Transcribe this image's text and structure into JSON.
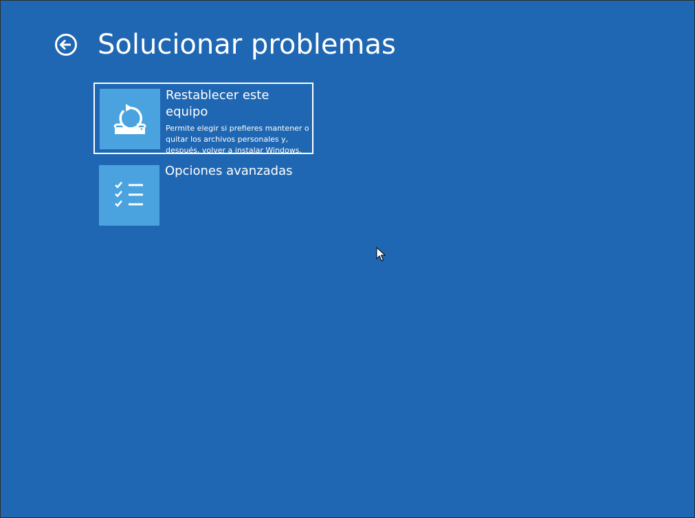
{
  "header": {
    "title": "Solucionar problemas",
    "back_icon": "back-arrow-circle-icon"
  },
  "tiles": [
    {
      "title": "Restablecer este equipo",
      "description": "Permite elegir si prefieres mantener o\nquitar los archivos personales y,\ndespués, volver a instalar Windows.",
      "icon": "reset-pc-icon",
      "selected": true
    },
    {
      "title": "Opciones avanzadas",
      "description": "",
      "icon": "checklist-icon",
      "selected": false
    }
  ],
  "colors": {
    "background": "#1f67b2",
    "tile_icon_bg": "#4aa3df",
    "text": "#ffffff",
    "selection_border": "#ffffff"
  }
}
